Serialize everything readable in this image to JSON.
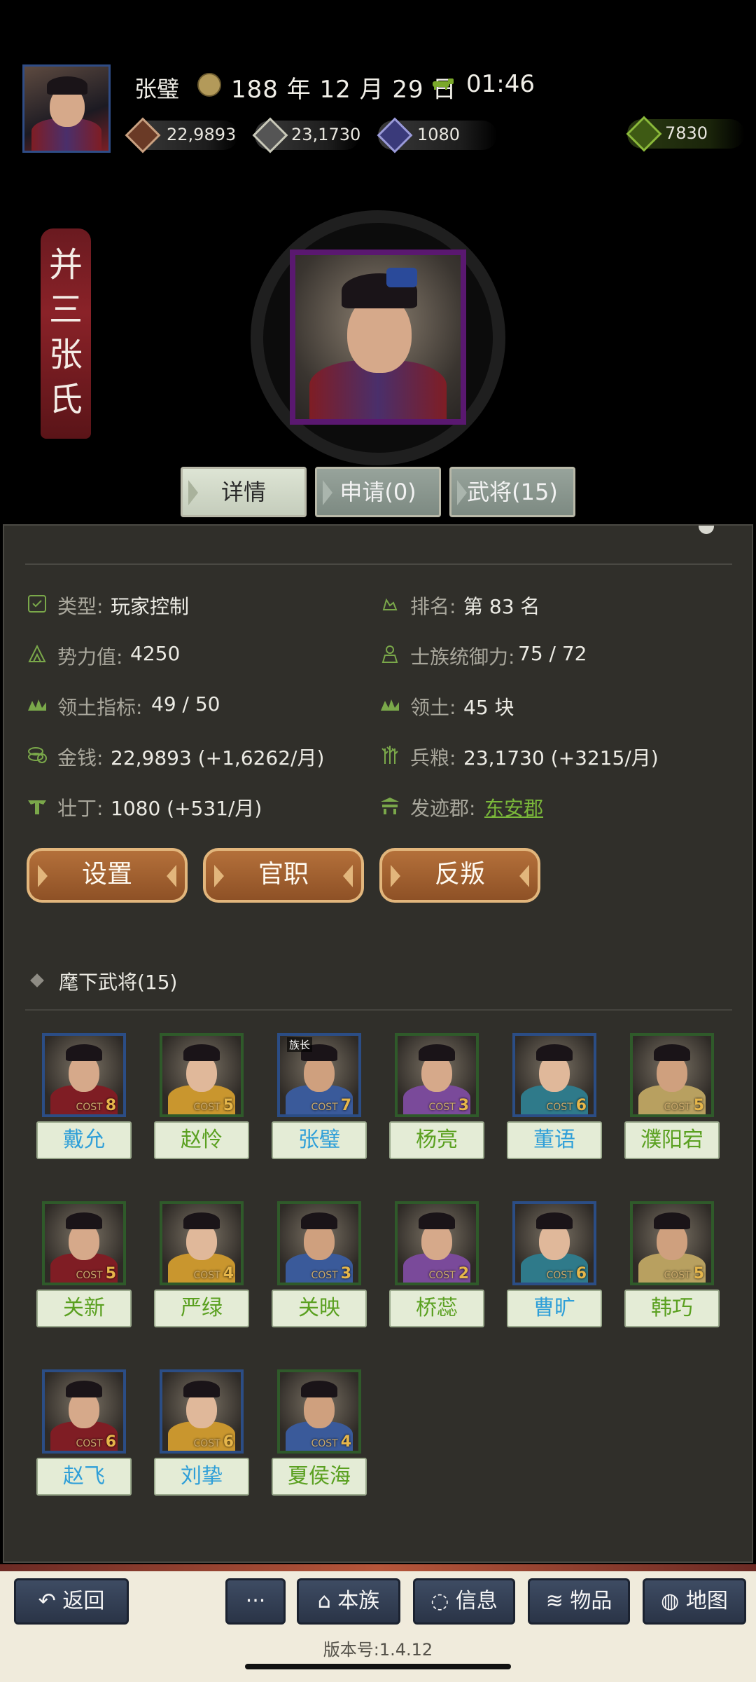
{
  "header": {
    "player_name": "张璧",
    "date": "188 年 12 月 29 日",
    "time": "01:46"
  },
  "resources": {
    "money": "22,9893",
    "grain": "23,1730",
    "manpower": "1080",
    "special": "7830"
  },
  "clan_banner": [
    "并",
    "三",
    "张",
    "氏"
  ],
  "tabs": [
    {
      "label": "详情",
      "active": true
    },
    {
      "label": "申请(0)",
      "active": false
    },
    {
      "label": "武将(15)",
      "active": false
    }
  ],
  "info": {
    "type_label": "类型:",
    "type_value": "玩家控制",
    "rank_label": "排名:",
    "rank_value": "第 83 名",
    "power_label": "势力值:",
    "power_value": "4250",
    "command_label": "士族统御力:",
    "command_value": "75 / 72",
    "territory_index_label": "领土指标:",
    "territory_index_value": "49 / 50",
    "territory_label": "领土:",
    "territory_value": "45 块",
    "money_label": "金钱:",
    "money_value": "22,9893 (+1,6262/月)",
    "grain_label": "兵粮:",
    "grain_value": "23,1730 (+3215/月)",
    "manpower_label": "壮丁:",
    "manpower_value": "1080 (+531/月)",
    "origin_label": "发迹郡:",
    "origin_value": "东安郡"
  },
  "actions": [
    "设置",
    "官职",
    "反叛"
  ],
  "generals_title": "麾下武将(15)",
  "generals": [
    {
      "name": "戴允",
      "cost": "8",
      "name_color": "blue",
      "frame": "blue"
    },
    {
      "name": "赵怜",
      "cost": "5",
      "name_color": "green",
      "frame": "green"
    },
    {
      "name": "张璧",
      "cost": "7",
      "name_color": "blue",
      "frame": "blue",
      "badge": "族长"
    },
    {
      "name": "杨亮",
      "cost": "3",
      "name_color": "green",
      "frame": "green"
    },
    {
      "name": "董语",
      "cost": "6",
      "name_color": "blue",
      "frame": "blue"
    },
    {
      "name": "濮阳宕",
      "cost": "5",
      "name_color": "green",
      "frame": "green"
    },
    {
      "name": "关新",
      "cost": "5",
      "name_color": "green",
      "frame": "green"
    },
    {
      "name": "严绿",
      "cost": "4",
      "name_color": "green",
      "frame": "green"
    },
    {
      "name": "关映",
      "cost": "3",
      "name_color": "green",
      "frame": "green"
    },
    {
      "name": "桥蕊",
      "cost": "2",
      "name_color": "green",
      "frame": "green"
    },
    {
      "name": "曹旷",
      "cost": "6",
      "name_color": "blue",
      "frame": "blue"
    },
    {
      "name": "韩巧",
      "cost": "5",
      "name_color": "green",
      "frame": "green"
    },
    {
      "name": "赵飞",
      "cost": "6",
      "name_color": "blue",
      "frame": "blue"
    },
    {
      "name": "刘挚",
      "cost": "6",
      "name_color": "blue",
      "frame": "blue"
    },
    {
      "name": "夏侯海",
      "cost": "4",
      "name_color": "green",
      "frame": "green"
    }
  ],
  "cost_label": "COST",
  "nav": {
    "back": "返回",
    "more": "···",
    "clan": "本族",
    "info": "信息",
    "items": "物品",
    "map": "地图"
  },
  "version": "版本号:1.4.12"
}
